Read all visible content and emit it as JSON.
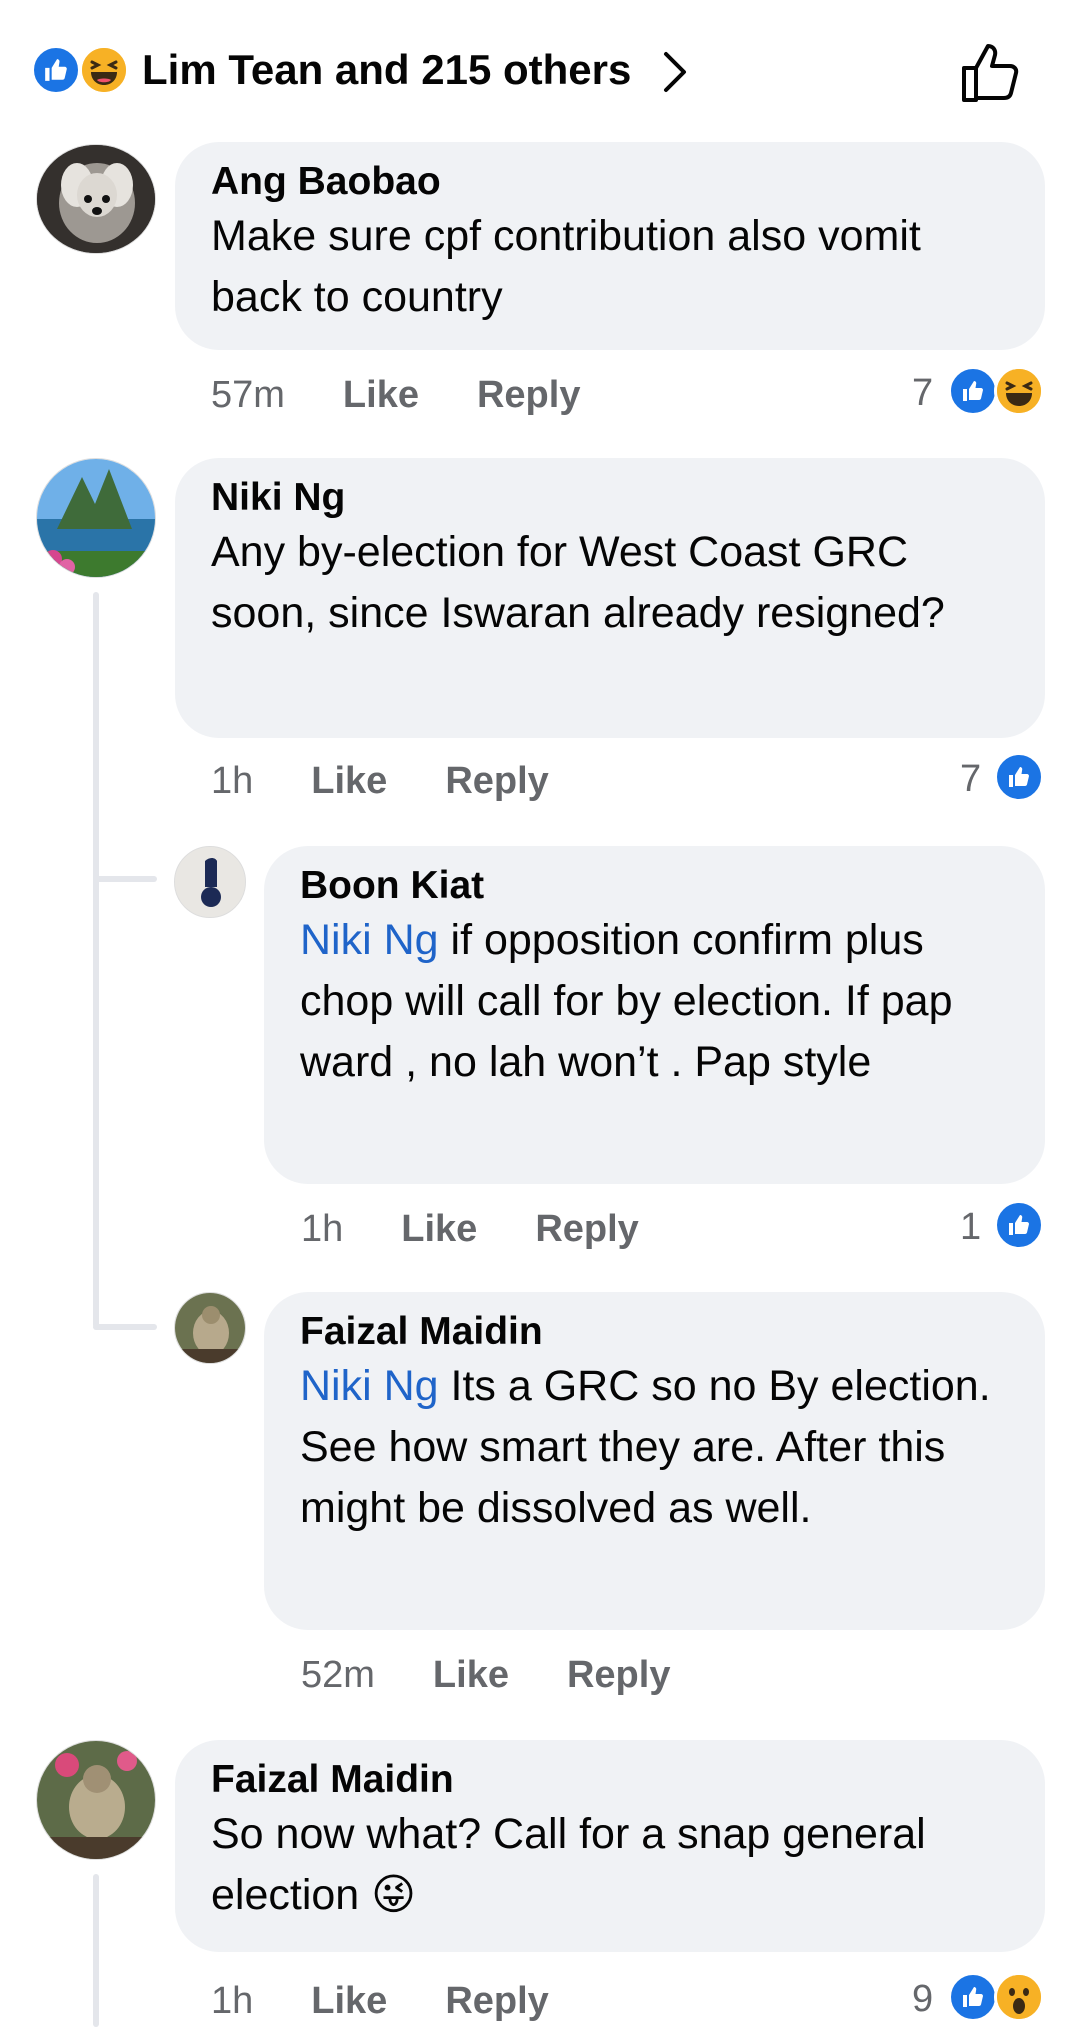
{
  "header": {
    "reaction_summary": "Lim Tean and 215 others",
    "reaction_icons": [
      "like-icon",
      "haha-icon"
    ]
  },
  "comments": [
    {
      "author": "Ang Baobao",
      "text": "Make sure cpf contribution also vomit back to country",
      "time": "57m",
      "like_label": "Like",
      "reply_label": "Reply",
      "reaction_count": "7",
      "reaction_icons": [
        "like-icon",
        "haha-icon"
      ]
    },
    {
      "author": "Niki Ng",
      "text": "Any by-election for West Coast GRC soon, since Iswaran already resigned?",
      "time": "1h",
      "like_label": "Like",
      "reply_label": "Reply",
      "reaction_count": "7",
      "reaction_icons": [
        "like-icon"
      ],
      "replies": [
        {
          "author": "Boon Kiat",
          "mention": "Niki Ng",
          "text": " if opposition confirm plus chop will call for by election. If pap ward , no lah won’t . Pap style",
          "time": "1h",
          "like_label": "Like",
          "reply_label": "Reply",
          "reaction_count": "1",
          "reaction_icons": [
            "like-icon"
          ]
        },
        {
          "author": "Faizal Maidin",
          "mention": "Niki Ng",
          "text": " Its a GRC so no By election. See how smart they are. After this might be dissolved as well.",
          "time": "52m",
          "like_label": "Like",
          "reply_label": "Reply"
        }
      ]
    },
    {
      "author": "Faizal Maidin",
      "text": "So now what? Call for a snap general election",
      "emoji": "😜",
      "time": "1h",
      "like_label": "Like",
      "reply_label": "Reply",
      "reaction_count": "9",
      "reaction_icons": [
        "like-icon",
        "wow-icon"
      ]
    }
  ],
  "colors": {
    "like": "#1b74e4",
    "mention": "#1f64c9",
    "bubble": "#f0f2f5",
    "meta": "#65676b"
  }
}
